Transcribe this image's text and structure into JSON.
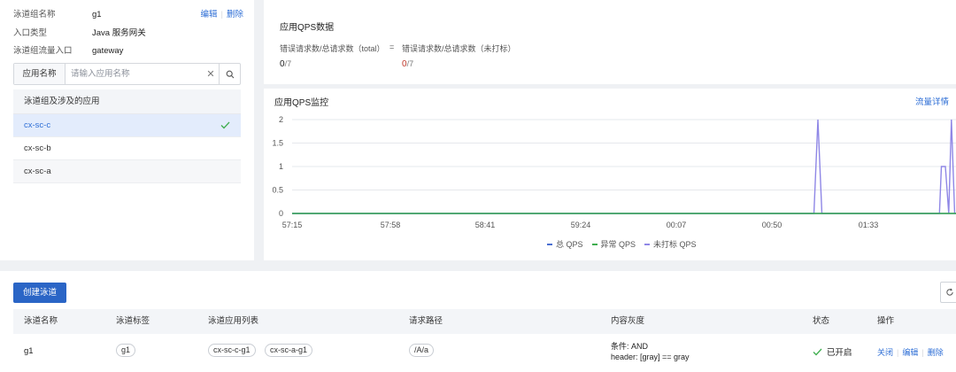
{
  "lane_group": {
    "name_label": "泳道组名称",
    "name_value": "g1",
    "edit_label": "编辑",
    "delete_label": "删除",
    "entry_type_label": "入口类型",
    "entry_type_value": "Java 服务网关",
    "entry_app_label": "泳道组流量入口",
    "entry_app_value": "gateway"
  },
  "search": {
    "label": "应用名称",
    "placeholder": "请输入应用名称"
  },
  "app_list": {
    "header": "泳道组及涉及的应用",
    "items": [
      {
        "name": "cx-sc-c",
        "selected": true
      },
      {
        "name": "cx-sc-b",
        "selected": false
      },
      {
        "name": "cx-sc-a",
        "selected": false
      }
    ]
  },
  "qps_data": {
    "title": "应用QPS数据",
    "formula_left": "错误请求数/总请求数（total）",
    "equals": "=",
    "formula_right": "错误请求数/总请求数（未打标）",
    "value_left_num": "0",
    "value_left_den": "/7",
    "value_right_num": "0",
    "value_right_den": "/7"
  },
  "monitor": {
    "title": "应用QPS监控",
    "detail_link": "流量详情"
  },
  "chart_data": {
    "type": "line",
    "yticks": [
      "0",
      "0.5",
      "1",
      "1.5",
      "2"
    ],
    "ylim": [
      0,
      2
    ],
    "xticks": [
      "57:15",
      "57:58",
      "58:41",
      "59:24",
      "00:07",
      "00:50",
      "01:33"
    ],
    "grid": true,
    "legend_position": "bottom",
    "series": [
      {
        "name": "总 QPS",
        "color": "#4a6fd1",
        "points": [
          [
            0,
            0
          ],
          [
            100,
            0
          ]
        ]
      },
      {
        "name": "异常 QPS",
        "color": "#3fae4f",
        "points": [
          [
            0,
            0
          ],
          [
            100,
            0
          ]
        ]
      },
      {
        "name": "未打标 QPS",
        "color": "#8f87e6",
        "points": [
          [
            0,
            0
          ],
          [
            78.6,
            0
          ],
          [
            79.2,
            2
          ],
          [
            79.8,
            0
          ],
          [
            97.5,
            0
          ],
          [
            97.8,
            1
          ],
          [
            98.4,
            1
          ],
          [
            98.9,
            0
          ],
          [
            99.3,
            2
          ],
          [
            99.8,
            0
          ],
          [
            100,
            0
          ]
        ]
      }
    ]
  },
  "toolbar": {
    "create_label": "创建泳道"
  },
  "table": {
    "headers": [
      "泳道名称",
      "泳道标签",
      "泳道应用列表",
      "请求路径",
      "内容灰度",
      "状态",
      "操作"
    ],
    "row": {
      "name": "g1",
      "tag": "g1",
      "apps": [
        "cx-sc-c-g1",
        "cx-sc-a-g1"
      ],
      "path": "/A/a",
      "gray_line1": "条件: AND",
      "gray_line2": "header: [gray] == gray",
      "status": "已开启",
      "status_color": "#3fae4f",
      "actions": [
        "关闭",
        "编辑",
        "删除"
      ]
    }
  },
  "colors": {
    "accent": "#2f6fd6",
    "primary_button": "#2a65c6",
    "error_value": "#c0392b"
  }
}
